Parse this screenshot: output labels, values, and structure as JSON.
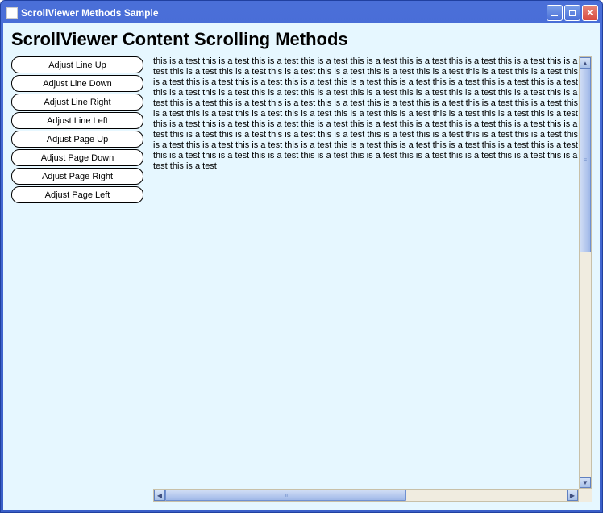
{
  "window": {
    "title": "ScrollViewer Methods Sample"
  },
  "heading": "ScrollViewer Content Scrolling Methods",
  "buttons": [
    "Adjust Line Up",
    "Adjust Line Down",
    "Adjust Line Right",
    "Adjust Line Left",
    "Adjust Page Up",
    "Adjust Page Down",
    "Adjust Page Right",
    "Adjust Page Left"
  ],
  "content_text": "this is a test this is a test this is a test this is a test this is a test this is a test this is a test this is a test this is a test this is a test this is a test this is a test this is a test this is a test this is a test this is a test this is a test this is a test this is a test this is a test this is a test this is a test this is a test this is a test this is a test this is a test this is a test this is a test this is a test this is a test this is a test this is a test this is a test this is a test this is a test this is a test this is a test this is a test this is a test this is a test this is a test this is a test this is a test this is a test this is a test this is a test this is a test this is a test this is a test this is a test this is a test this is a test this is a test this is a test this is a test this is a test this is a test this is a test this is a test this is a test this is a test this is a test this is a test this is a test this is a test this is a test this is a test this is a test this is a test this is a test this is a test this is a test this is a test this is a test this is a test this is a test this is a test this is a test this is a test this is a test this is a test this is a test this is a test this is a test this is a test this is a test this is a test this is a test"
}
